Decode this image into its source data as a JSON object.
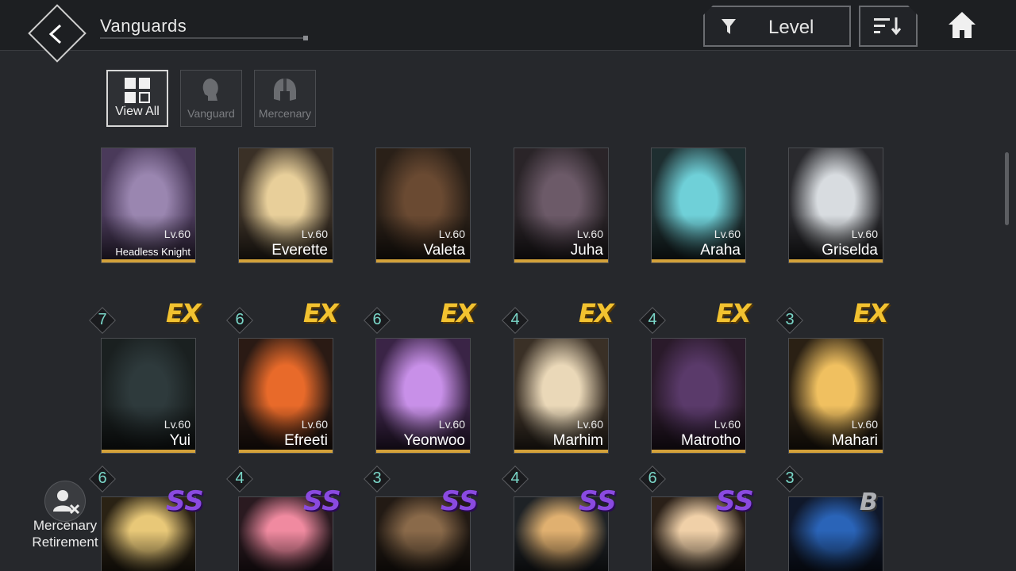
{
  "header": {
    "title": "Vanguards",
    "filter_label": "Level",
    "back_icon": "back-arrow-icon",
    "filter_icon": "funnel-icon",
    "sort_icon": "sort-icon",
    "home_icon": "home-icon"
  },
  "tabs": [
    {
      "label": "View All",
      "icon": "grid-icon",
      "active": true
    },
    {
      "label": "Vanguard",
      "icon": "head-icon",
      "active": false
    },
    {
      "label": "Mercenary",
      "icon": "helmet-icon",
      "active": false
    }
  ],
  "rows": [
    [
      {
        "name": "Headless Knight",
        "level": "Lv.60",
        "color1": "#4a3a5a",
        "color2": "#9a86b0",
        "badge": "",
        "grade": ""
      },
      {
        "name": "Everette",
        "level": "Lv.60",
        "color1": "#3a3026",
        "color2": "#e8cf9a",
        "badge": "",
        "grade": ""
      },
      {
        "name": "Valeta",
        "level": "Lv.60",
        "color1": "#2a2018",
        "color2": "#6a4a32",
        "badge": "",
        "grade": ""
      },
      {
        "name": "Juha",
        "level": "Lv.60",
        "color1": "#2a2428",
        "color2": "#6c5a68",
        "badge": "",
        "grade": ""
      },
      {
        "name": "Araha",
        "level": "Lv.60",
        "color1": "#1e2e30",
        "color2": "#6fd0d8",
        "badge": "",
        "grade": ""
      },
      {
        "name": "Griselda",
        "level": "Lv.60",
        "color1": "#2a2a2e",
        "color2": "#d8dce0",
        "badge": "",
        "grade": ""
      }
    ],
    [
      {
        "name": "Yui",
        "level": "Lv.60",
        "color1": "#1a2020",
        "color2": "#2e3a3c",
        "badge": "7",
        "grade": "EX"
      },
      {
        "name": "Efreeti",
        "level": "Lv.60",
        "color1": "#2a1a14",
        "color2": "#e86a2a",
        "badge": "6",
        "grade": "EX"
      },
      {
        "name": "Yeonwoo",
        "level": "Lv.60",
        "color1": "#3a2446",
        "color2": "#c890e8",
        "badge": "6",
        "grade": "EX"
      },
      {
        "name": "Marhim",
        "level": "Lv.60",
        "color1": "#3a3026",
        "color2": "#ead8b8",
        "badge": "4",
        "grade": "EX"
      },
      {
        "name": "Matrotho",
        "level": "Lv.60",
        "color1": "#2a1a2a",
        "color2": "#5a3a6a",
        "badge": "4",
        "grade": "EX"
      },
      {
        "name": "Mahari",
        "level": "Lv.60",
        "color1": "#2a2014",
        "color2": "#f0c060",
        "badge": "3",
        "grade": "EX"
      }
    ],
    [
      {
        "name": "",
        "level": "",
        "color1": "#2a2214",
        "color2": "#e8c878",
        "badge": "6",
        "grade": "SS"
      },
      {
        "name": "",
        "level": "",
        "color1": "#2a1a20",
        "color2": "#f08aa0",
        "badge": "4",
        "grade": "SS"
      },
      {
        "name": "",
        "level": "",
        "color1": "#221a14",
        "color2": "#8a6a4a",
        "badge": "3",
        "grade": "SS"
      },
      {
        "name": "",
        "level": "",
        "color1": "#1e2226",
        "color2": "#e0b070",
        "badge": "4",
        "grade": "SS"
      },
      {
        "name": "",
        "level": "",
        "color1": "#2a2018",
        "color2": "#f0d0a8",
        "badge": "6",
        "grade": "SS"
      },
      {
        "name": "",
        "level": "",
        "color1": "#10182a",
        "color2": "#2a64b8",
        "badge": "3",
        "grade": "B"
      }
    ]
  ],
  "retirement": {
    "label_line1": "Mercenary",
    "label_line2": "Retirement",
    "icon": "remove-user-icon"
  },
  "colors": {
    "accent_gold": "#d4a23a",
    "ex_gold": "#f2c230",
    "ss_purple": "#8a4ae0",
    "badge_teal": "#7ad6c8"
  }
}
